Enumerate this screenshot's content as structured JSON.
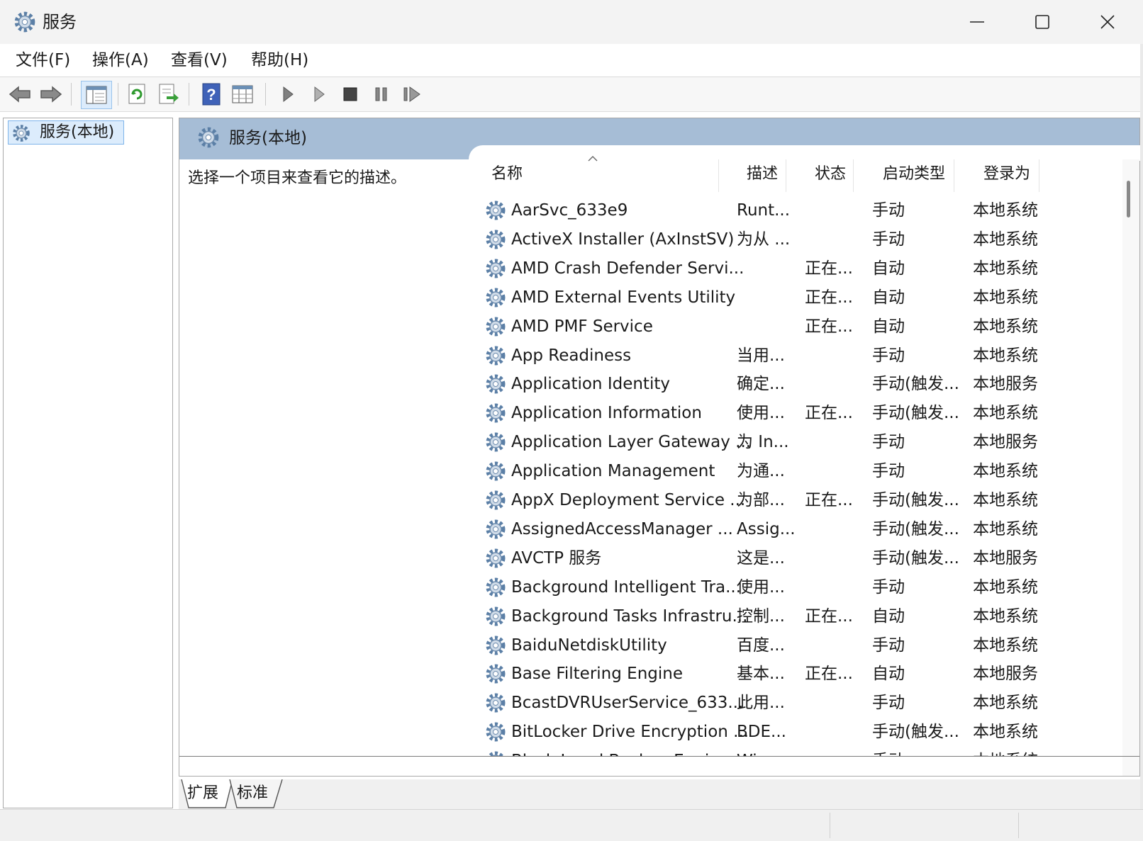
{
  "window": {
    "title": "服务",
    "icon": "gear-services-icon",
    "controls": [
      "minimize-icon",
      "maximize-icon",
      "close-icon"
    ]
  },
  "menu": [
    "文件(F)",
    "操作(A)",
    "查看(V)",
    "帮助(H)"
  ],
  "toolbar": [
    "back-arrow-icon",
    "forward-arrow-icon",
    "show-hide-console-tree-icon",
    "refresh-icon",
    "export-list-icon",
    "help-icon",
    "properties-view-icon",
    "start-service-icon",
    "start-alt-icon",
    "stop-service-icon",
    "pause-service-icon",
    "resume-service-icon"
  ],
  "tree": {
    "label": "服务(本地)"
  },
  "pane": {
    "title": "服务(本地)",
    "description": "选择一个项目来查看它的描述。"
  },
  "columns": {
    "name": "名称",
    "desc": "描述",
    "status": "状态",
    "startup": "启动类型",
    "logon": "登录为"
  },
  "rows": [
    {
      "name": "AarSvc_633e9",
      "desc": "Runt...",
      "status": "",
      "startup": "手动",
      "logon": "本地系统"
    },
    {
      "name": "ActiveX Installer (AxInstSV)",
      "desc": "为从 ...",
      "status": "",
      "startup": "手动",
      "logon": "本地系统"
    },
    {
      "name": "AMD Crash Defender Servi...",
      "desc": "",
      "status": "正在...",
      "startup": "自动",
      "logon": "本地系统"
    },
    {
      "name": "AMD External Events Utility",
      "desc": "",
      "status": "正在...",
      "startup": "自动",
      "logon": "本地系统"
    },
    {
      "name": "AMD PMF Service",
      "desc": "",
      "status": "正在...",
      "startup": "自动",
      "logon": "本地系统"
    },
    {
      "name": "App Readiness",
      "desc": "当用...",
      "status": "",
      "startup": "手动",
      "logon": "本地系统"
    },
    {
      "name": "Application Identity",
      "desc": "确定...",
      "status": "",
      "startup": "手动(触发...",
      "logon": "本地服务"
    },
    {
      "name": "Application Information",
      "desc": "使用...",
      "status": "正在...",
      "startup": "手动(触发...",
      "logon": "本地系统"
    },
    {
      "name": "Application Layer Gateway ...",
      "desc": "为 In...",
      "status": "",
      "startup": "手动",
      "logon": "本地服务"
    },
    {
      "name": "Application Management",
      "desc": "为通...",
      "status": "",
      "startup": "手动",
      "logon": "本地系统"
    },
    {
      "name": "AppX Deployment Service ...",
      "desc": "为部...",
      "status": "正在...",
      "startup": "手动(触发...",
      "logon": "本地系统"
    },
    {
      "name": "AssignedAccessManager ...",
      "desc": "Assig...",
      "status": "",
      "startup": "手动(触发...",
      "logon": "本地系统"
    },
    {
      "name": "AVCTP 服务",
      "desc": "这是...",
      "status": "",
      "startup": "手动(触发...",
      "logon": "本地服务"
    },
    {
      "name": "Background Intelligent Tra...",
      "desc": "使用...",
      "status": "",
      "startup": "手动",
      "logon": "本地系统"
    },
    {
      "name": "Background Tasks Infrastru...",
      "desc": "控制...",
      "status": "正在...",
      "startup": "自动",
      "logon": "本地系统"
    },
    {
      "name": "BaiduNetdiskUtility",
      "desc": "百度...",
      "status": "",
      "startup": "手动",
      "logon": "本地系统"
    },
    {
      "name": "Base Filtering Engine",
      "desc": "基本...",
      "status": "正在...",
      "startup": "自动",
      "logon": "本地服务"
    },
    {
      "name": "BcastDVRUserService_633...",
      "desc": "此用...",
      "status": "",
      "startup": "手动",
      "logon": "本地系统"
    },
    {
      "name": "BitLocker Drive Encryption ...",
      "desc": "BDE...",
      "status": "",
      "startup": "手动(触发...",
      "logon": "本地系统"
    },
    {
      "name": "Block Level Backup Engine ...",
      "desc": "Win...",
      "status": "",
      "startup": "手动",
      "logon": "本地系统"
    }
  ],
  "tabs": [
    "扩展",
    "标准"
  ],
  "colors": {
    "header": "#a6bdd6",
    "selection": "#dcecfc",
    "selection_border": "#7eb4ea"
  }
}
